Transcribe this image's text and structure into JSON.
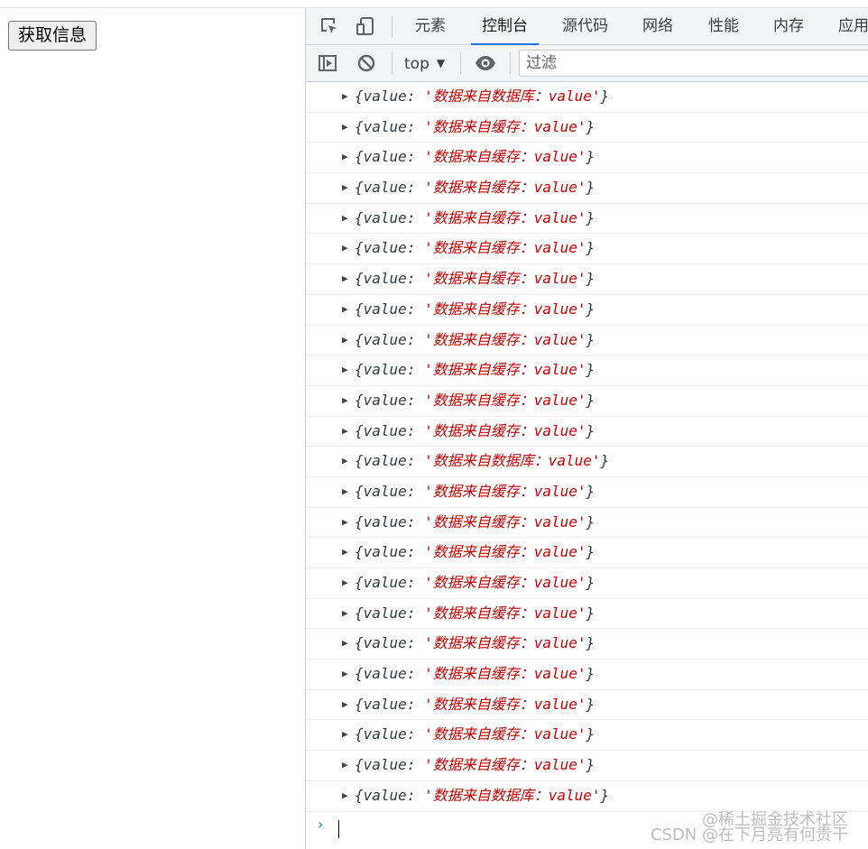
{
  "page": {
    "button_label": "获取信息"
  },
  "devtools": {
    "tabs": [
      "元素",
      "控制台",
      "源代码",
      "网络",
      "性能",
      "内存",
      "应用"
    ],
    "active_tab": "控制台",
    "context_label": "top",
    "filter_placeholder": "过滤",
    "console_entries": [
      {
        "key": "value",
        "val": "数据来自数据库：value"
      },
      {
        "key": "value",
        "val": "数据来自缓存：value"
      },
      {
        "key": "value",
        "val": "数据来自缓存：value"
      },
      {
        "key": "value",
        "val": "数据来自缓存：value"
      },
      {
        "key": "value",
        "val": "数据来自缓存：value"
      },
      {
        "key": "value",
        "val": "数据来自缓存：value"
      },
      {
        "key": "value",
        "val": "数据来自缓存：value"
      },
      {
        "key": "value",
        "val": "数据来自缓存：value"
      },
      {
        "key": "value",
        "val": "数据来自缓存：value"
      },
      {
        "key": "value",
        "val": "数据来自缓存：value"
      },
      {
        "key": "value",
        "val": "数据来自缓存：value"
      },
      {
        "key": "value",
        "val": "数据来自缓存：value"
      },
      {
        "key": "value",
        "val": "数据来自数据库：value"
      },
      {
        "key": "value",
        "val": "数据来自缓存：value"
      },
      {
        "key": "value",
        "val": "数据来自缓存：value"
      },
      {
        "key": "value",
        "val": "数据来自缓存：value"
      },
      {
        "key": "value",
        "val": "数据来自缓存：value"
      },
      {
        "key": "value",
        "val": "数据来自缓存：value"
      },
      {
        "key": "value",
        "val": "数据来自缓存：value"
      },
      {
        "key": "value",
        "val": "数据来自缓存：value"
      },
      {
        "key": "value",
        "val": "数据来自缓存：value"
      },
      {
        "key": "value",
        "val": "数据来自缓存：value"
      },
      {
        "key": "value",
        "val": "数据来自缓存：value"
      },
      {
        "key": "value",
        "val": "数据来自数据库：value"
      }
    ],
    "prompt_symbol": "›"
  },
  "watermarks": [
    "@稀土掘金技术社区",
    "CSDN @在下月亮有何贵干"
  ],
  "colors": {
    "active_tab_underline": "#1a73e8",
    "string_value": "#c80000",
    "prompt": "#1a73e8"
  }
}
